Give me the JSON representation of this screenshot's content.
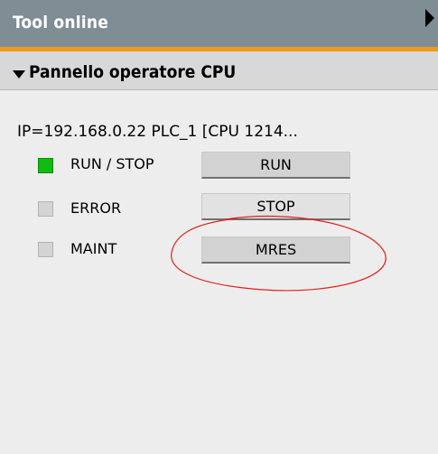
{
  "panel": {
    "title": "Tool online",
    "section_title": "Pannello operatore CPU"
  },
  "connection": {
    "text": "IP=192.168.0.22 PLC_1 [CPU 1214..."
  },
  "status_rows": [
    {
      "label": "RUN / STOP",
      "led_state": "on",
      "led_color": "#12bb12"
    },
    {
      "label": "ERROR",
      "led_state": "off",
      "led_color": "#d4d4d4"
    },
    {
      "label": "MAINT",
      "led_state": "off",
      "led_color": "#d4d4d4"
    }
  ],
  "buttons": {
    "run": "RUN",
    "stop": "STOP",
    "mres": "MRES"
  },
  "annotation": {
    "highlight_color": "#e0201e",
    "target": "mres-button"
  }
}
